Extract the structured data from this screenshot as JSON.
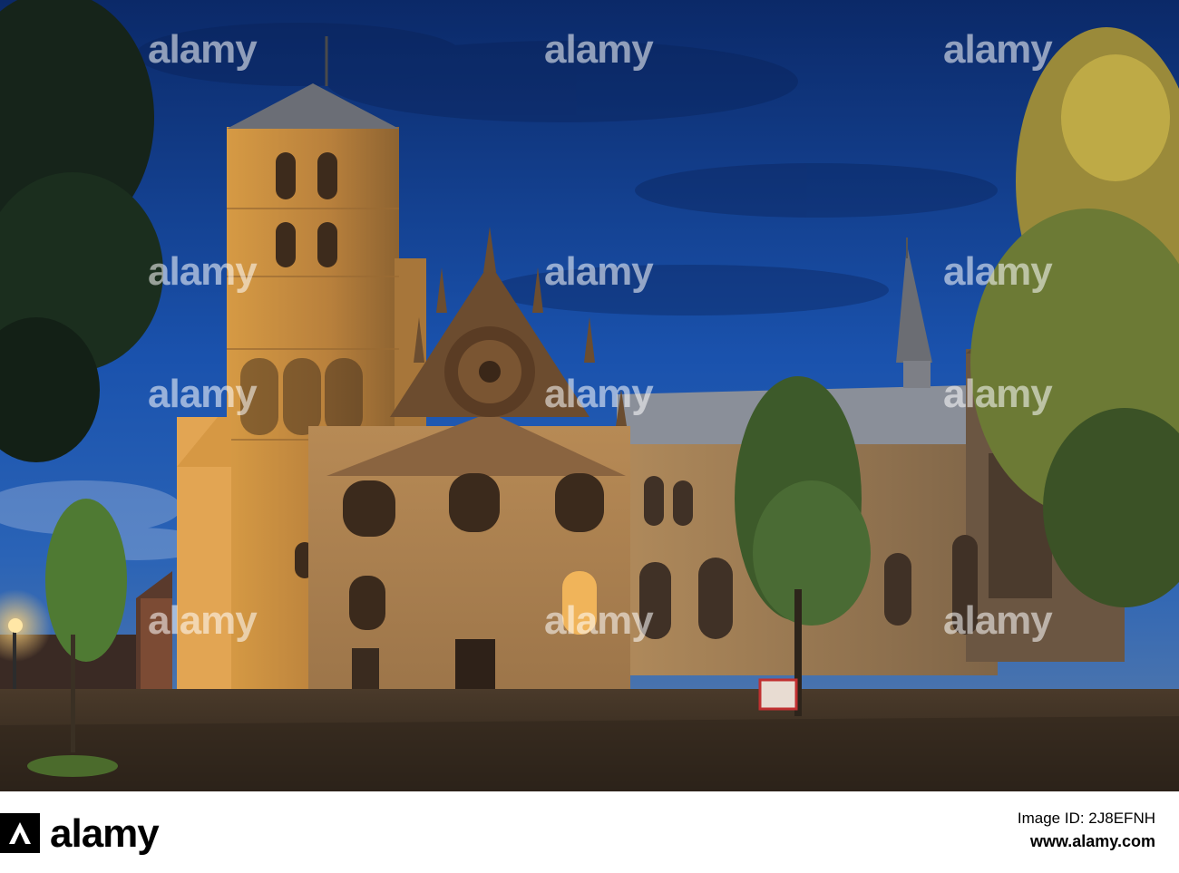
{
  "watermark": {
    "text": "alamy",
    "color": "#ffffff"
  },
  "footer": {
    "brand": "alamy",
    "image_id_label": "Image ID: 2J8EFNH",
    "site": "www.alamy.com"
  },
  "colors": {
    "sky_top": "#0d2d6e",
    "sky_mid": "#1e58b4",
    "stone_lit": "#c98a3a",
    "pavement": "#3a3026"
  }
}
